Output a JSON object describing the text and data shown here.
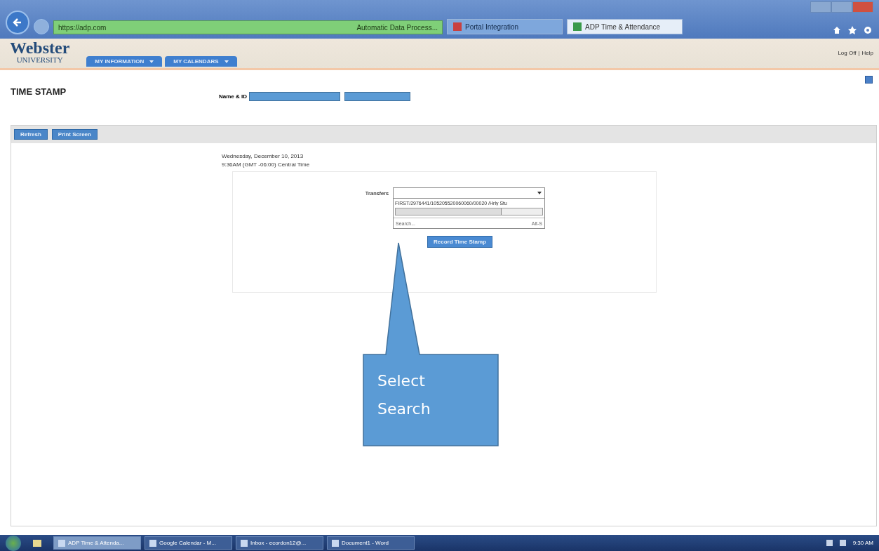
{
  "browser": {
    "address": "https://adp.com",
    "site_identity": "Automatic Data Process...",
    "tabs": [
      {
        "label": "Portal Integration",
        "selected": false
      },
      {
        "label": "ADP Time & Attendance",
        "selected": true
      }
    ]
  },
  "header": {
    "logo_top": "Webster",
    "logo_bottom": "UNIVERSITY",
    "nav": [
      "MY INFORMATION",
      "MY CALENDARS"
    ],
    "links": [
      "Log Off",
      "|",
      "Help"
    ]
  },
  "page": {
    "title": "TIME STAMP",
    "name_label": "Name & ID",
    "toolbar": [
      "Refresh",
      "Print Screen"
    ],
    "date": "Wednesday, December 10, 2013",
    "time": "9:36AM (GMT -06:00) Central Time",
    "transfers": {
      "label": "Transfers",
      "option": "FIRST/2976441/105205520060060/00020 /Hrly Stu",
      "search": "Search...",
      "shortcut": "Alt-S"
    },
    "record_button": "Record Time Stamp"
  },
  "callout": {
    "lines": [
      "Select",
      "Search"
    ]
  },
  "taskbar": {
    "items": [
      {
        "label": "ADP Time & Attenda...",
        "selected": true
      },
      {
        "label": "Google Calendar - M...",
        "selected": false
      },
      {
        "label": "Inbox - ecordon12@...",
        "selected": false
      },
      {
        "label": "Document1 - Word",
        "selected": false
      }
    ],
    "clock": "9:30 AM"
  }
}
